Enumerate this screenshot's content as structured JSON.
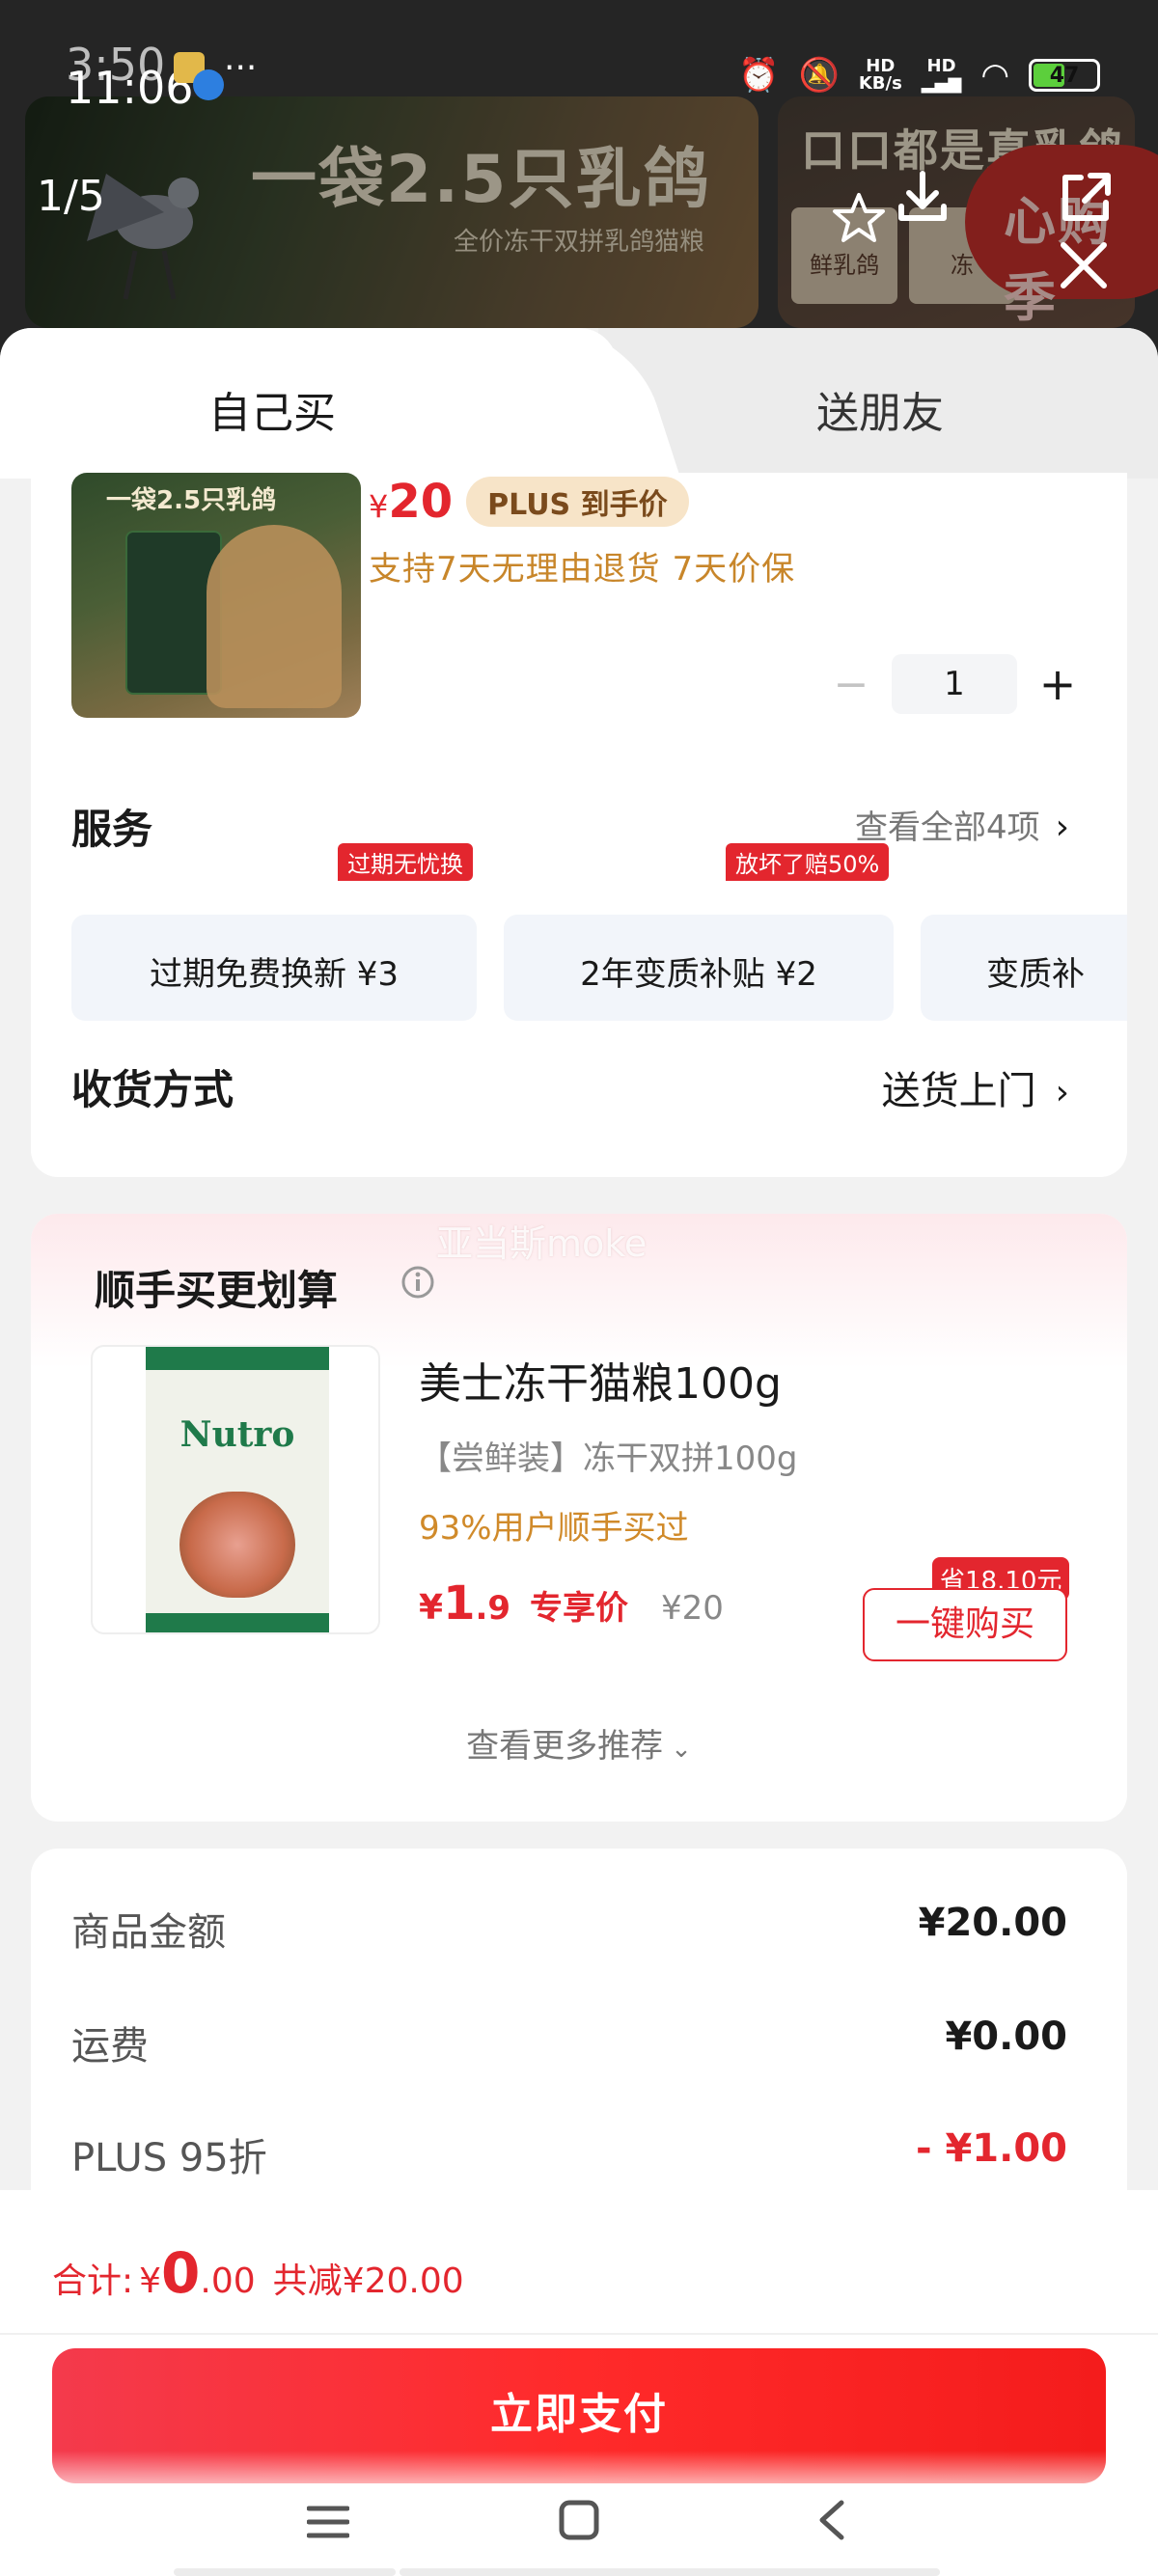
{
  "status_bar": {
    "time_overlay": "3:50",
    "time": "11:06",
    "dots": "···",
    "hd1": "HD",
    "net_speed": "KB/s",
    "hd2": "HD",
    "battery": "47"
  },
  "gallery": {
    "counter": "1/5",
    "headline": "一袋2.5只乳鸽",
    "subline": "全价冻干双拼乳鸽猫粮",
    "secondary_headline": "口口都是真乳鸽",
    "secondary_cards": [
      "鲜乳鸽",
      "冻"
    ],
    "promo_text": "心购季"
  },
  "tabs": {
    "self": "自己买",
    "friend": "送朋友"
  },
  "product": {
    "thumb_title": "一袋2.5只乳鸽",
    "price_yen": "¥",
    "price": "20",
    "plus_badge": "PLUS 到手价",
    "policy": "支持7天无理由退货  7天价保",
    "quantity": "1"
  },
  "service": {
    "title": "服务",
    "view_all": "查看全部4项",
    "tiles": [
      {
        "label": "过期免费换新  ¥3",
        "tag": "过期无忧换"
      },
      {
        "label": "2年变质补贴  ¥2",
        "tag": "放坏了赔50%"
      },
      {
        "label": "变质补"
      }
    ]
  },
  "shipping": {
    "title": "收货方式",
    "value": "送货上门"
  },
  "recommend": {
    "watermark": "亚当斯moke",
    "title": "顺手买更划算",
    "bag_logo": "Nutro",
    "name": "美士冻干猫粮100g",
    "spec": "【尝鲜装】冻干双拼100g",
    "social": "93%用户顺手买过",
    "price_yen": "¥",
    "price_int": "1",
    "price_dec": ".9",
    "price_label": "专享价",
    "original_price": "¥20",
    "save_tag": "省18.10元",
    "buy_button": "一键购买",
    "more": "查看更多推荐"
  },
  "price_detail": {
    "rows": [
      {
        "label": "商品金额",
        "value": "¥20.00"
      },
      {
        "label": "运费",
        "value": "¥0.00"
      },
      {
        "label": "PLUS 95折",
        "value": "- ¥1.00"
      }
    ]
  },
  "footer": {
    "total_label": "合计:",
    "total_yen": "¥",
    "total_int": "0",
    "total_dec": ".00",
    "discount": "共减¥20.00",
    "pay_button": "立即支付"
  },
  "colors": {
    "accent_red": "#e3262e",
    "plus_gold": "#c8862a",
    "plus_badge_bg": "#f7e4c8"
  }
}
